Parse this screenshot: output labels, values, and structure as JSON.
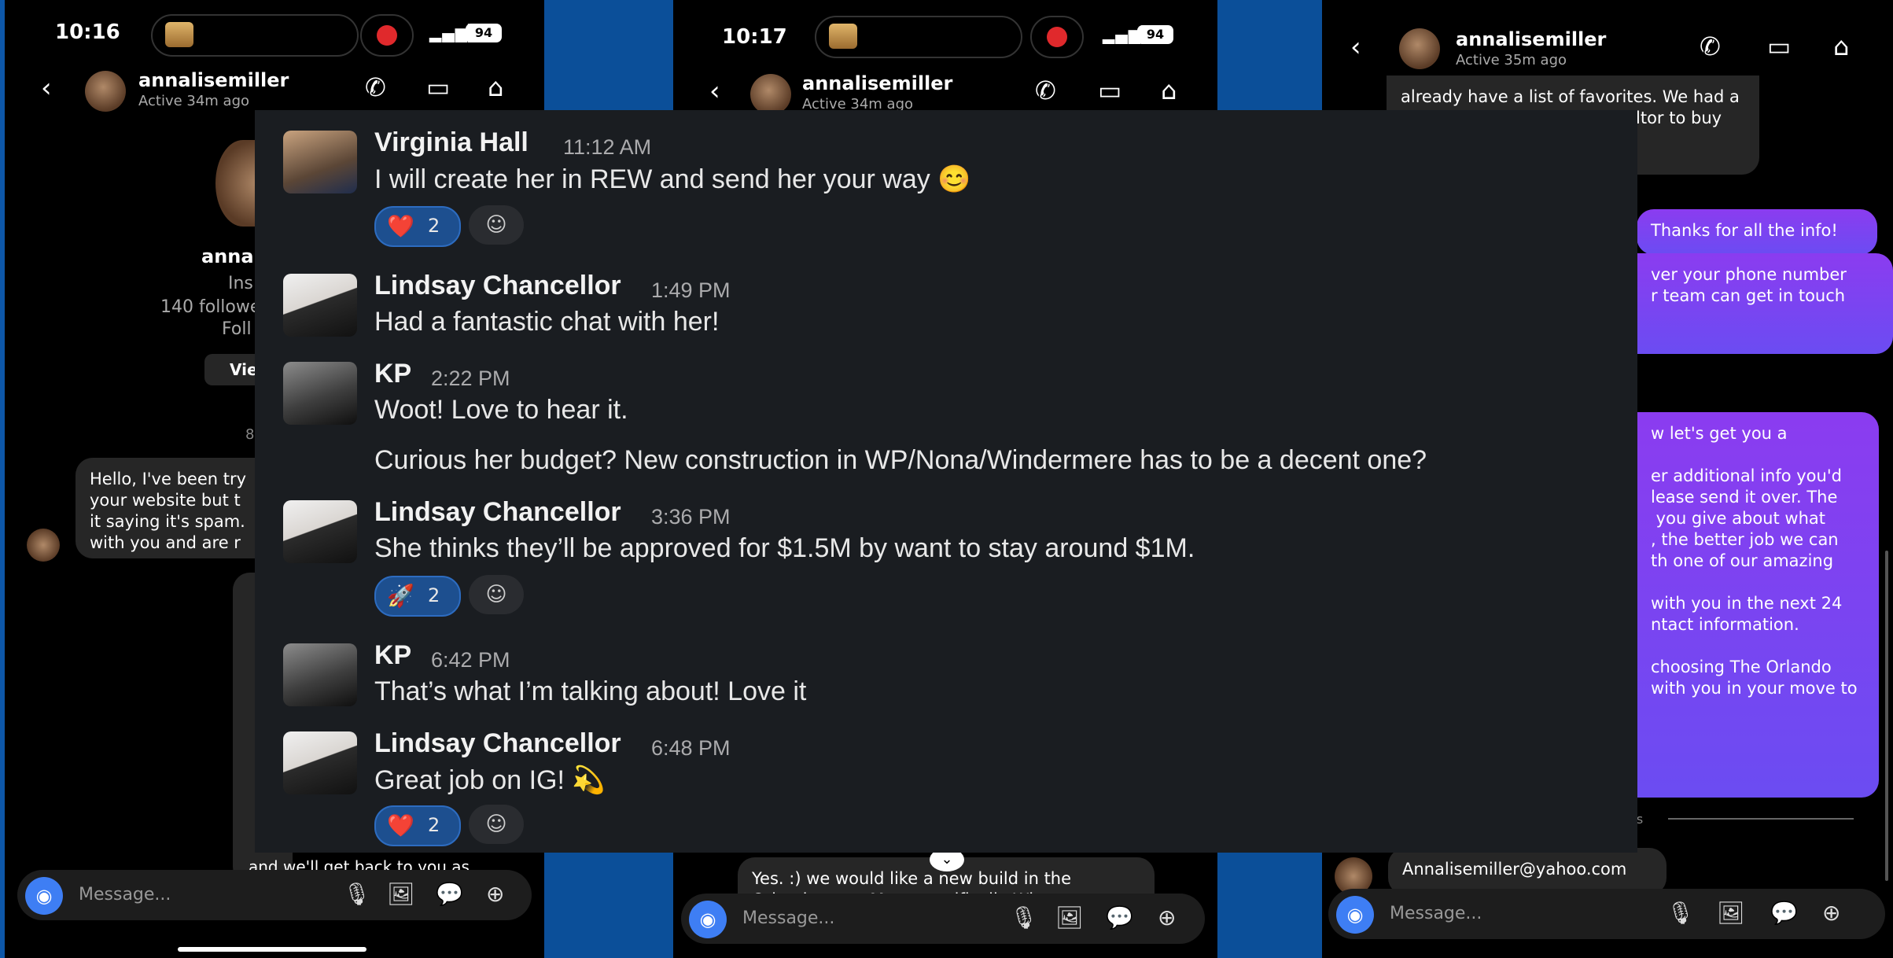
{
  "phones": [
    {
      "time": "10:16",
      "battery": "94",
      "username": "annalisemiller",
      "active": "Active 34m ago",
      "profile": {
        "name": "annal",
        "sub": "Ins",
        "followers": "140 followe",
        "follow": "Foll",
        "view": "Vie",
        "date": "8"
      },
      "incoming": "Hello, I've been try\nyour website but t\nit saying it's spam.\nwith you and are r",
      "outgoing_tail": "and we'll get back to you as",
      "placeholder": "Message..."
    },
    {
      "time": "10:17",
      "battery": "94",
      "username": "annalisemiller",
      "active": "Active 34m ago",
      "incoming": "Yes. :) we would like a new build in the\nOrlando area. More specifically Winter",
      "placeholder": "Message..."
    },
    {
      "username": "annalisemiller",
      "active": "Active 35m ago",
      "incoming_top": "already have a list of favorites. We had a\ngood experience using a realtor to buy\ns so would like\nved your videos!",
      "sent": "Thanks for all the info!",
      "purple1": "ver your phone number\nr team can get in touch",
      "purple2": "w let's get you a\n\ner additional info you'd\nlease send it over. The\n you give about what\n, the better job we can\nth one of our amazing\n\nwith you in the next 24\nntact information.\n\nchoosing The Orlando\nwith you in your move to",
      "divider": "es",
      "email": "Annalisemiller@yahoo.com",
      "placeholder": "Message..."
    }
  ],
  "slack": {
    "messages": [
      {
        "name": "Virginia Hall",
        "time": "11:12 AM",
        "text": "I will create her in REW and send her your way 😊",
        "reaction": {
          "emoji": "❤️",
          "count": "2"
        }
      },
      {
        "name": "Lindsay Chancellor",
        "time": "1:49 PM",
        "text": "Had a fantastic chat with her!"
      },
      {
        "name": "KP",
        "time": "2:22 PM",
        "text": "Woot! Love to hear it.",
        "text2": "Curious her budget? New construction in WP/Nona/Windermere has to be a decent one?"
      },
      {
        "name": "Lindsay Chancellor",
        "time": "3:36 PM",
        "text": "She thinks they’ll be approved for $1.5M by want to stay around $1M.",
        "reaction": {
          "emoji": "🚀",
          "count": "2"
        }
      },
      {
        "name": "KP",
        "time": "6:42 PM",
        "text": "That’s what I’m talking about! Love it"
      },
      {
        "name": "Lindsay Chancellor",
        "time": "6:48 PM",
        "text": "Great job on IG! 💫",
        "reaction": {
          "emoji": "❤️",
          "count": "2"
        }
      }
    ]
  }
}
